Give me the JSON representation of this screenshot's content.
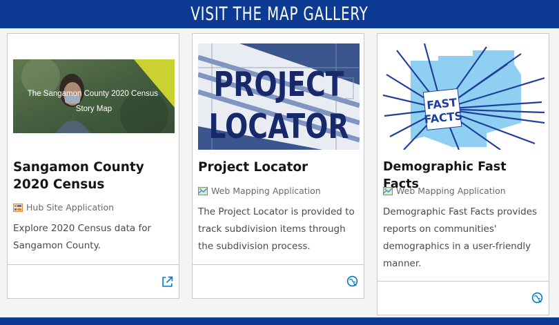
{
  "banner": {
    "title": "Visit the Map Gallery"
  },
  "cards": [
    {
      "title": "Sangamon County 2020 Census",
      "type_label": "Hub Site Application",
      "description": "Explore 2020 Census data for Sangamon County.",
      "thumbnail_text": "The Sangamon County 2020 Census Story Map",
      "action_icon": "external-link-icon"
    },
    {
      "title": "Project Locator",
      "type_label": "Web Mapping Application",
      "description": "The Project Locator is provided to track subdivision items through the subdivision process.",
      "thumbnail_text": [
        "PROJECT",
        "LOCATOR"
      ],
      "action_icon": "launch-app-icon"
    },
    {
      "title": "Demographic Fast Facts",
      "type_label": "Web Mapping Application",
      "description": "Demographic Fast Facts provides reports on communities' demographics in a user-friendly manner.",
      "thumbnail_text": [
        "FAST",
        "FACTS"
      ],
      "action_icon": "launch-app-icon"
    }
  ],
  "colors": {
    "banner": "#0d3b94",
    "accent": "#0079c1"
  }
}
